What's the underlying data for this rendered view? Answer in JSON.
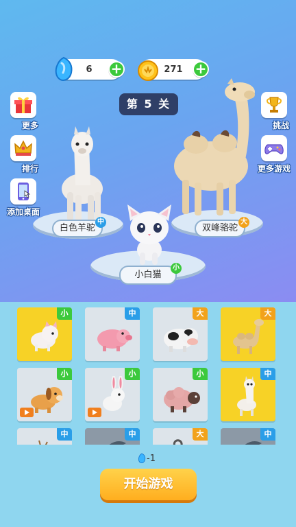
{
  "resources": {
    "gems": "6",
    "coins": "271"
  },
  "level_label": "第 5 关",
  "side_left": [
    {
      "label": "更多",
      "icon": "gift-icon"
    },
    {
      "label": "排行",
      "icon": "crown-icon"
    },
    {
      "label": "添加桌面",
      "icon": "phone-icon"
    }
  ],
  "side_right": [
    {
      "label": "挑战",
      "icon": "trophy-icon"
    },
    {
      "label": "更多游戏",
      "icon": "gamepad-icon"
    }
  ],
  "stage_animals": [
    {
      "name": "白色羊驼",
      "size": "中"
    },
    {
      "name": "双峰骆驼",
      "size": "大"
    },
    {
      "name": "小白猫",
      "size": "小"
    }
  ],
  "colors": {
    "small": "#3cc93c",
    "medium": "#2a9ee8",
    "large": "#f2a21b",
    "selected": "#f7d226"
  },
  "cards": [
    {
      "animal": "cat",
      "size": "小",
      "selected": true,
      "video": false
    },
    {
      "animal": "pig",
      "size": "中",
      "selected": false,
      "video": false
    },
    {
      "animal": "cow",
      "size": "大",
      "selected": false,
      "video": false
    },
    {
      "animal": "camel",
      "size": "大",
      "selected": true,
      "video": false
    },
    {
      "animal": "dog",
      "size": "小",
      "selected": false,
      "video": true
    },
    {
      "animal": "rabbit",
      "size": "小",
      "selected": false,
      "video": true
    },
    {
      "animal": "sheep",
      "size": "小",
      "selected": false,
      "video": false
    },
    {
      "animal": "alpaca",
      "size": "中",
      "selected": true,
      "video": false
    },
    {
      "animal": "deer",
      "size": "中",
      "selected": false,
      "video": false
    },
    {
      "animal": "locked",
      "size": "中",
      "selected": false,
      "video": false
    },
    {
      "animal": "goat",
      "size": "大",
      "selected": false,
      "video": false
    },
    {
      "animal": "locked",
      "size": "中",
      "selected": false,
      "video": false
    }
  ],
  "cost_label": "-1",
  "start_button": "开始游戏"
}
